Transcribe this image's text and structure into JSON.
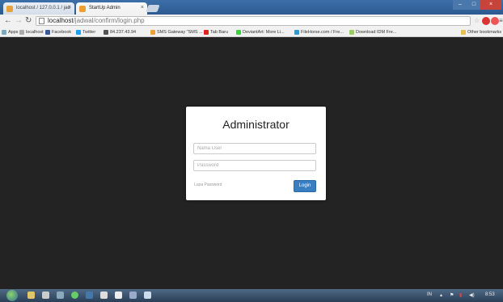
{
  "browser": {
    "tabs": [
      {
        "label": "localhost / 127.0.0.1 / jad",
        "active": false
      },
      {
        "label": "StartUp Admin",
        "active": true
      }
    ],
    "url_host": "localhost",
    "url_path": "/jadwal/confirm/login.php",
    "bookmarks": [
      "Apps",
      "localhost",
      "Facebook",
      "Twitter",
      "84.237.43.94",
      "SMS Gateway \"SMS ...",
      "Tab Baru",
      "DeviantArt: More Li...",
      "FileHorse.com / Fre...",
      "Download IDM Fre...",
      "Other bookmarks"
    ]
  },
  "login": {
    "title": "Administrator",
    "username_placeholder": "Nama User",
    "password_placeholder": "Password",
    "forgot_label": "Lupa Password",
    "login_button": "Login"
  },
  "taskbar": {
    "lang": "IN",
    "time": "8:53"
  },
  "colors": {
    "page_bg": "#232323",
    "login_button": "#3a7ec2"
  }
}
